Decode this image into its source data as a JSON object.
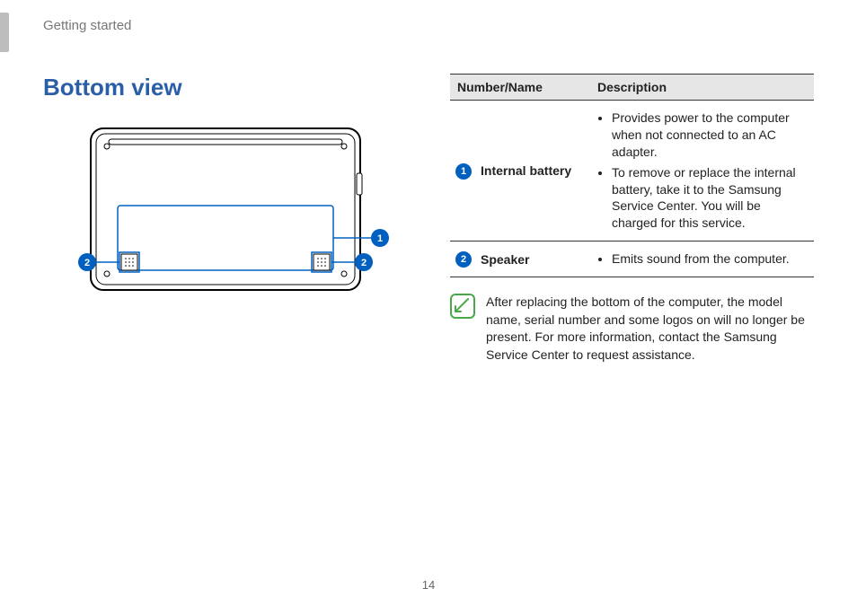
{
  "header": {
    "section": "Getting started"
  },
  "title": "Bottom view",
  "callouts": {
    "c1": "1",
    "c2": "2"
  },
  "table": {
    "headers": {
      "numname": "Number/Name",
      "desc": "Description"
    },
    "rows": [
      {
        "num": "1",
        "name": "Internal battery",
        "desc": [
          "Provides power to the computer when not connected to an AC adapter.",
          "To remove or replace the internal battery, take it to the Samsung Service Center. You will be charged for this service."
        ]
      },
      {
        "num": "2",
        "name": "Speaker",
        "desc": [
          "Emits sound from the computer."
        ]
      }
    ]
  },
  "note": "After replacing the bottom of the computer, the model name, serial number and some logos on will no longer be present. For more information, contact the Samsung Service Center to request assistance.",
  "page_number": "14"
}
